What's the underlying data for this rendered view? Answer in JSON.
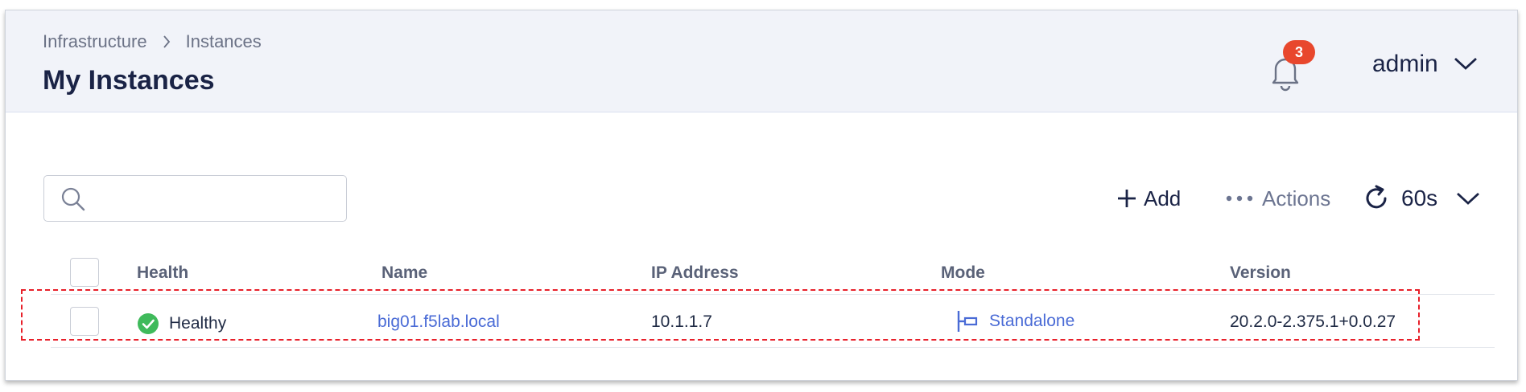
{
  "header": {
    "breadcrumb": [
      "Infrastructure",
      "Instances"
    ],
    "title": "My Instances",
    "notifications_count": "3",
    "user": "admin"
  },
  "toolbar": {
    "search_placeholder": "",
    "add_label": "Add",
    "actions_label": "Actions",
    "refresh_interval": "60s"
  },
  "table": {
    "columns": [
      "Health",
      "Name",
      "IP Address",
      "Mode",
      "Version"
    ],
    "rows": [
      {
        "health": "Healthy",
        "name": "big01.f5lab.local",
        "ip": "10.1.1.7",
        "mode": "Standalone",
        "version": "20.2.0-2.375.1+0.0.27"
      }
    ]
  },
  "colors": {
    "header_bg": "#f1f3f9",
    "title": "#1a2346",
    "link": "#4a6bd6",
    "badge": "#e8472d",
    "healthy": "#3fba5b",
    "highlight": "#e8202a"
  },
  "icons": [
    "chevron-right-icon",
    "bell-icon",
    "chevron-down-icon",
    "search-icon",
    "plus-icon",
    "more-dots-icon",
    "refresh-icon",
    "healthy-check-icon",
    "standalone-mode-icon"
  ]
}
